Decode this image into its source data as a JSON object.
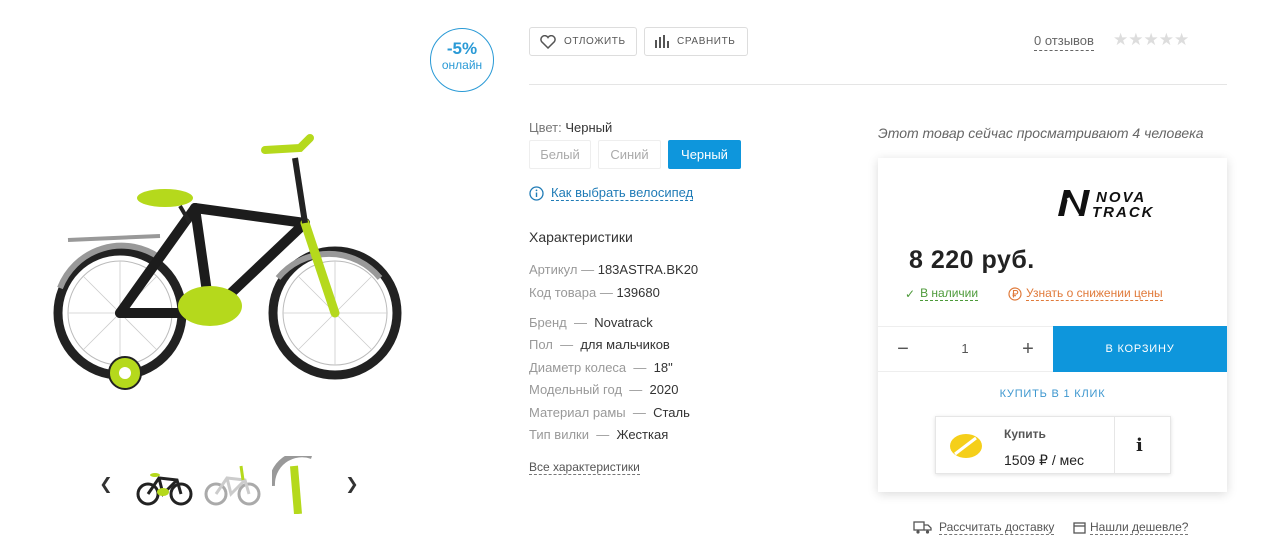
{
  "badge": {
    "percent": "-5%",
    "label": "онлайн"
  },
  "toolbar": {
    "postpone": "ОТЛОЖИТЬ",
    "compare": "СРАВНИТЬ"
  },
  "reviews": {
    "text": "0 отзывов",
    "rating": 0,
    "max": 5
  },
  "color": {
    "title": "Цвет:",
    "selected": "Черный",
    "options": [
      "Белый",
      "Синий",
      "Черный"
    ]
  },
  "howto_link": "Как выбрать велосипед",
  "characteristics": {
    "title": "Характеристики",
    "items": [
      {
        "name": "Артикул",
        "sep": "—",
        "value": "183ASTRA.BK20"
      },
      {
        "name": "Код товара",
        "sep": "—",
        "value": "139680"
      },
      {
        "name": "Бренд",
        "sep": "—",
        "value": "Novatrack"
      },
      {
        "name": "Пол",
        "sep": "—",
        "value": "для мальчиков"
      },
      {
        "name": "Диаметр колеса",
        "sep": "—",
        "value": "18\""
      },
      {
        "name": "Модельный год",
        "sep": "—",
        "value": "2020"
      },
      {
        "name": "Материал рамы",
        "sep": "—",
        "value": "Сталь"
      },
      {
        "name": "Тип вилки",
        "sep": "—",
        "value": "Жесткая"
      }
    ],
    "all_link": "Все характеристики"
  },
  "watching": "Этот товар сейчас просматривают 4 человека",
  "buy": {
    "brand_logo_text": "NOVA TRACK",
    "price": "8 220 руб.",
    "in_stock": "В наличии",
    "notify": "Узнать о снижении цены",
    "qty": "1",
    "cart": "В КОРЗИНУ",
    "one_click": "КУПИТЬ В 1 КЛИК",
    "installment_label": "Купить",
    "installment_amount": "1509 ₽ / мес",
    "info_icon": "i"
  },
  "footer": {
    "delivery": "Рассчитать доставку",
    "cheaper": "Нашли дешевле?"
  },
  "colors": {
    "accent": "#0e96dc",
    "lime": "#b5d91c",
    "green": "#4d9a3a",
    "orange": "#e07a3a"
  },
  "icons": [
    "heart-icon",
    "bars-icon",
    "info-icon",
    "check-icon",
    "ruble-bell-icon",
    "truck-icon",
    "wallet-icon",
    "chevron-left-icon",
    "chevron-right-icon"
  ]
}
